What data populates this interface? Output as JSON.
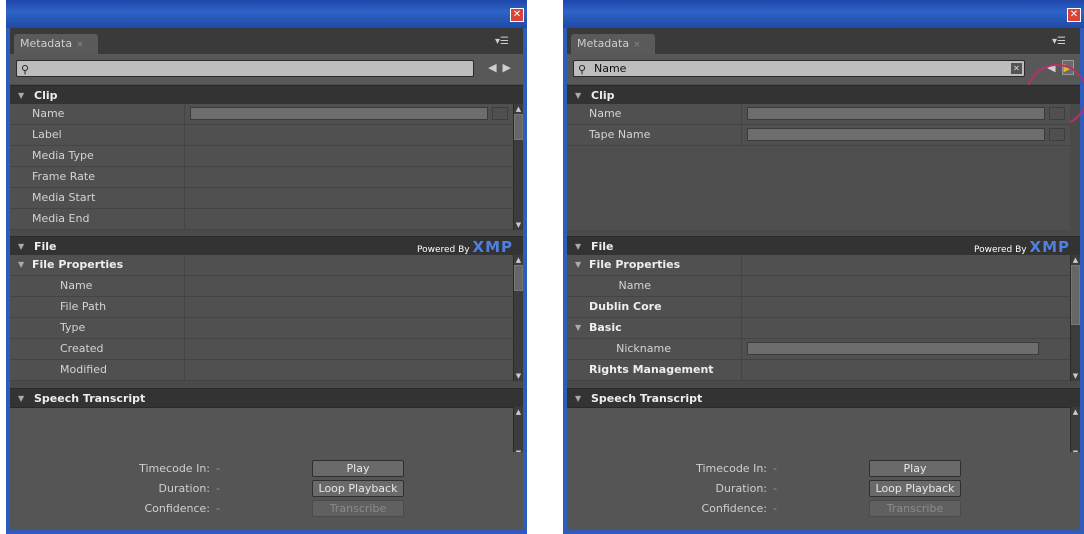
{
  "left": {
    "tab_label": "Metadata",
    "search_value": "",
    "clip": {
      "header": "Clip",
      "rows": [
        "Name",
        "Label",
        "Media Type",
        "Frame Rate",
        "Media Start",
        "Media End"
      ]
    },
    "file": {
      "header": "File",
      "powered_by": "Powered By",
      "xmp": "XMP",
      "group": "File Properties",
      "rows": [
        "Name",
        "File Path",
        "Type",
        "Created",
        "Modified"
      ]
    },
    "speech": {
      "header": "Speech Transcript"
    },
    "bottom": {
      "timecode_label": "Timecode In:",
      "timecode_value": "-",
      "duration_label": "Duration:",
      "duration_value": "-",
      "confidence_label": "Confidence:",
      "confidence_value": "-",
      "play": "Play",
      "loop": "Loop Playback",
      "transcribe": "Transcribe"
    }
  },
  "right": {
    "tab_label": "Metadata",
    "search_value": "Name",
    "clip": {
      "header": "Clip",
      "rows": [
        "Name",
        "Tape Name"
      ]
    },
    "file": {
      "header": "File",
      "powered_by": "Powered By",
      "xmp": "XMP",
      "rows": [
        {
          "label": "File Properties",
          "kind": "group"
        },
        {
          "label": "Name",
          "kind": "sub"
        },
        {
          "label": "Dublin Core",
          "kind": "bold"
        },
        {
          "label": "Basic",
          "kind": "group"
        },
        {
          "label": "Nickname",
          "kind": "sub"
        },
        {
          "label": "Rights Management",
          "kind": "bold"
        }
      ]
    },
    "speech": {
      "header": "Speech Transcript"
    },
    "bottom": {
      "timecode_label": "Timecode In:",
      "timecode_value": "-",
      "duration_label": "Duration:",
      "duration_value": "-",
      "confidence_label": "Confidence:",
      "confidence_value": "-",
      "play": "Play",
      "loop": "Loop Playback",
      "transcribe": "Transcribe"
    }
  },
  "colors": {
    "title_bar": "#2e63c8",
    "highlight_circle": "#b2316a",
    "xmp": "#4f7fe0"
  }
}
